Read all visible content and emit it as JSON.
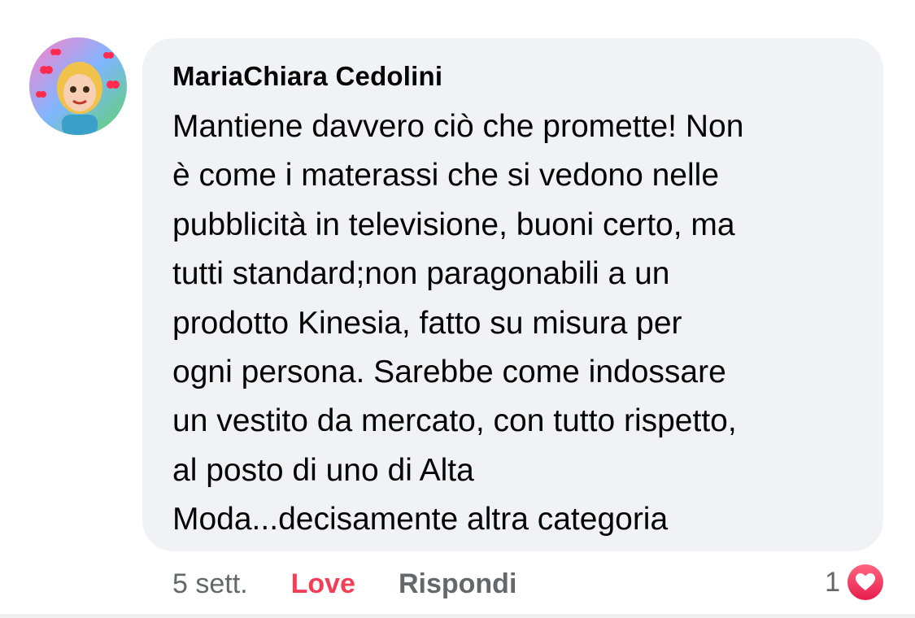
{
  "comment": {
    "author": "MariaChiara Cedolini",
    "text": "Mantiene davvero ciò che promette! Non\nè come i materassi che si vedono nelle\npubblicità  in televisione, buoni certo, ma\ntutti standard;non paragonabili a un\nprodotto Kinesia, fatto  su misura per\nogni persona. Sarebbe come indossare\nun vestito da mercato, con tutto rispetto,\nal posto di uno di Alta\nModa...decisamente altra categoria",
    "avatar_icon": "avatar-image"
  },
  "actions": {
    "timestamp": "5 sett.",
    "reaction_label": "Love",
    "reply_label": "Rispondi"
  },
  "reactions": {
    "count": "1",
    "icon": "heart-reaction-icon"
  },
  "colors": {
    "bubble": "#f0f2f5",
    "love": "#f33e58",
    "secondary_text": "#65676b"
  }
}
